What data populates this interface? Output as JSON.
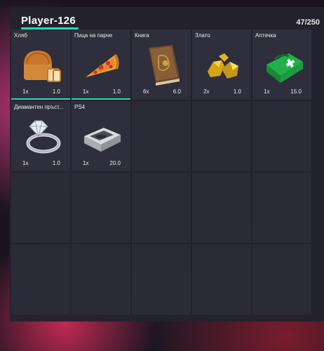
{
  "player": {
    "name": "Player-126",
    "weight": "47/250"
  },
  "colors": {
    "accent": "#2fd6b0",
    "panel": "#22222e",
    "slot": "#2b2b38"
  },
  "items": [
    {
      "name": "Хляб",
      "qty": "1x",
      "weight": "1.0",
      "icon": "bread-icon",
      "hotbar": true
    },
    {
      "name": "Пица на парче",
      "qty": "1x",
      "weight": "1.0",
      "icon": "pizza-slice-icon",
      "hotbar": true
    },
    {
      "name": "Книга",
      "qty": "6x",
      "weight": "6.0",
      "icon": "book-icon",
      "hotbar": false
    },
    {
      "name": "Злато",
      "qty": "2x",
      "weight": "1.0",
      "icon": "gold-nugget-icon",
      "hotbar": false
    },
    {
      "name": "Аптечка",
      "qty": "1x",
      "weight": "15.0",
      "icon": "first-aid-kit-icon",
      "hotbar": false
    },
    {
      "name": "Диамантен пръст...",
      "qty": "1x",
      "weight": "1.0",
      "icon": "diamond-ring-icon",
      "hotbar": false
    },
    {
      "name": "PS4",
      "qty": "1x",
      "weight": "20.0",
      "icon": "game-console-icon",
      "hotbar": false
    }
  ]
}
